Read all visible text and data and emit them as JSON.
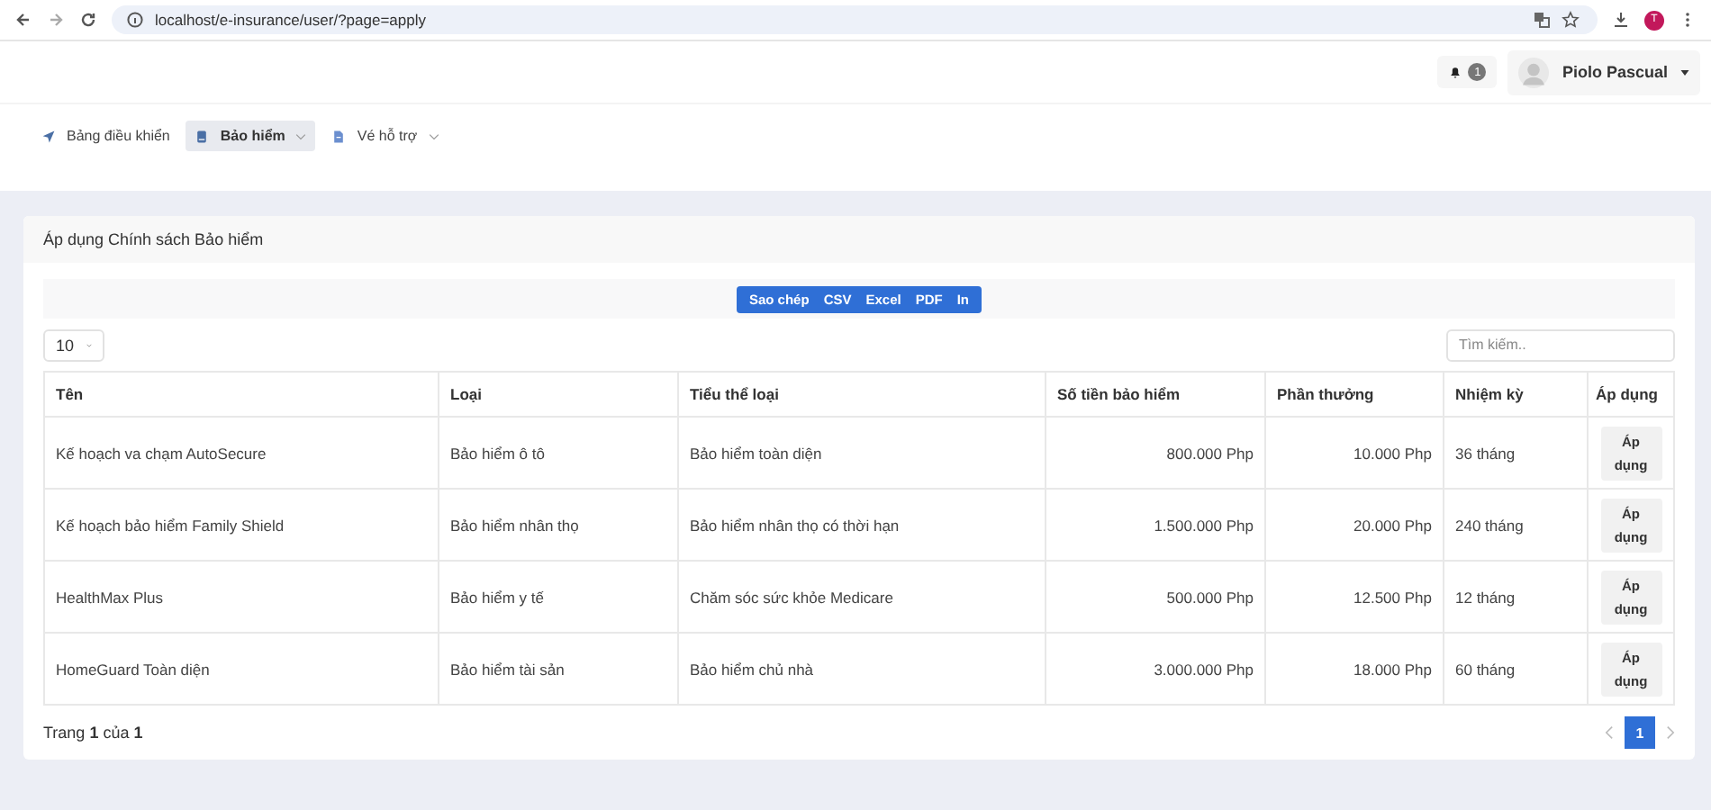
{
  "browser": {
    "url": "localhost/e-insurance/user/?page=apply",
    "profile_initial": "T"
  },
  "header": {
    "notifications": "1",
    "user": "Piolo Pascual"
  },
  "nav": [
    {
      "label": "Bảng điều khiển",
      "kind": "dashboard",
      "selected": false,
      "dropdown": false
    },
    {
      "label": "Bảo hiểm",
      "kind": "insurance",
      "selected": true,
      "dropdown": true
    },
    {
      "label": "Vé hỗ trợ",
      "kind": "ticket",
      "selected": false,
      "dropdown": true
    }
  ],
  "card": {
    "title": "Áp dụng Chính sách Bảo hiểm",
    "export_buttons": [
      "Sao chép",
      "CSV",
      "Excel",
      "PDF",
      "In"
    ],
    "page_size": "10",
    "search": {
      "placeholder": "Tìm kiếm.."
    },
    "table": {
      "columns": [
        "Tên",
        "Loại",
        "Tiểu thể loại",
        "Số tiền bảo hiểm",
        "Phần thưởng",
        "Nhiệm kỳ",
        "Áp dụng"
      ],
      "rows": [
        {
          "cells": [
            "Kế hoạch va chạm AutoSecure",
            "Bảo hiểm ô tô",
            "Bảo hiểm toàn diện",
            "800.000 Php",
            "10.000 Php",
            "36 tháng"
          ],
          "action": "Áp dụng"
        },
        {
          "cells": [
            "Kế hoạch bảo hiểm Family Shield",
            "Bảo hiểm nhân thọ",
            "Bảo hiểm nhân thọ có thời hạn",
            "1.500.000 Php",
            "20.000 Php",
            "240 tháng"
          ],
          "action": "Áp dụng"
        },
        {
          "cells": [
            "HealthMax Plus",
            "Bảo hiểm y tế",
            "Chăm sóc sức khỏe Medicare",
            "500.000 Php",
            "12.500 Php",
            "12 tháng"
          ],
          "action": "Áp dụng"
        },
        {
          "cells": [
            "HomeGuard Toàn diện",
            "Bảo hiểm tài sản",
            "Bảo hiểm chủ nhà",
            "3.000.000 Php",
            "18.000 Php",
            "60 tháng"
          ],
          "action": "Áp dụng"
        }
      ]
    },
    "footer": "Trang **1** của **1**",
    "pages": [
      {
        "label": "1",
        "selected": true
      }
    ]
  }
}
